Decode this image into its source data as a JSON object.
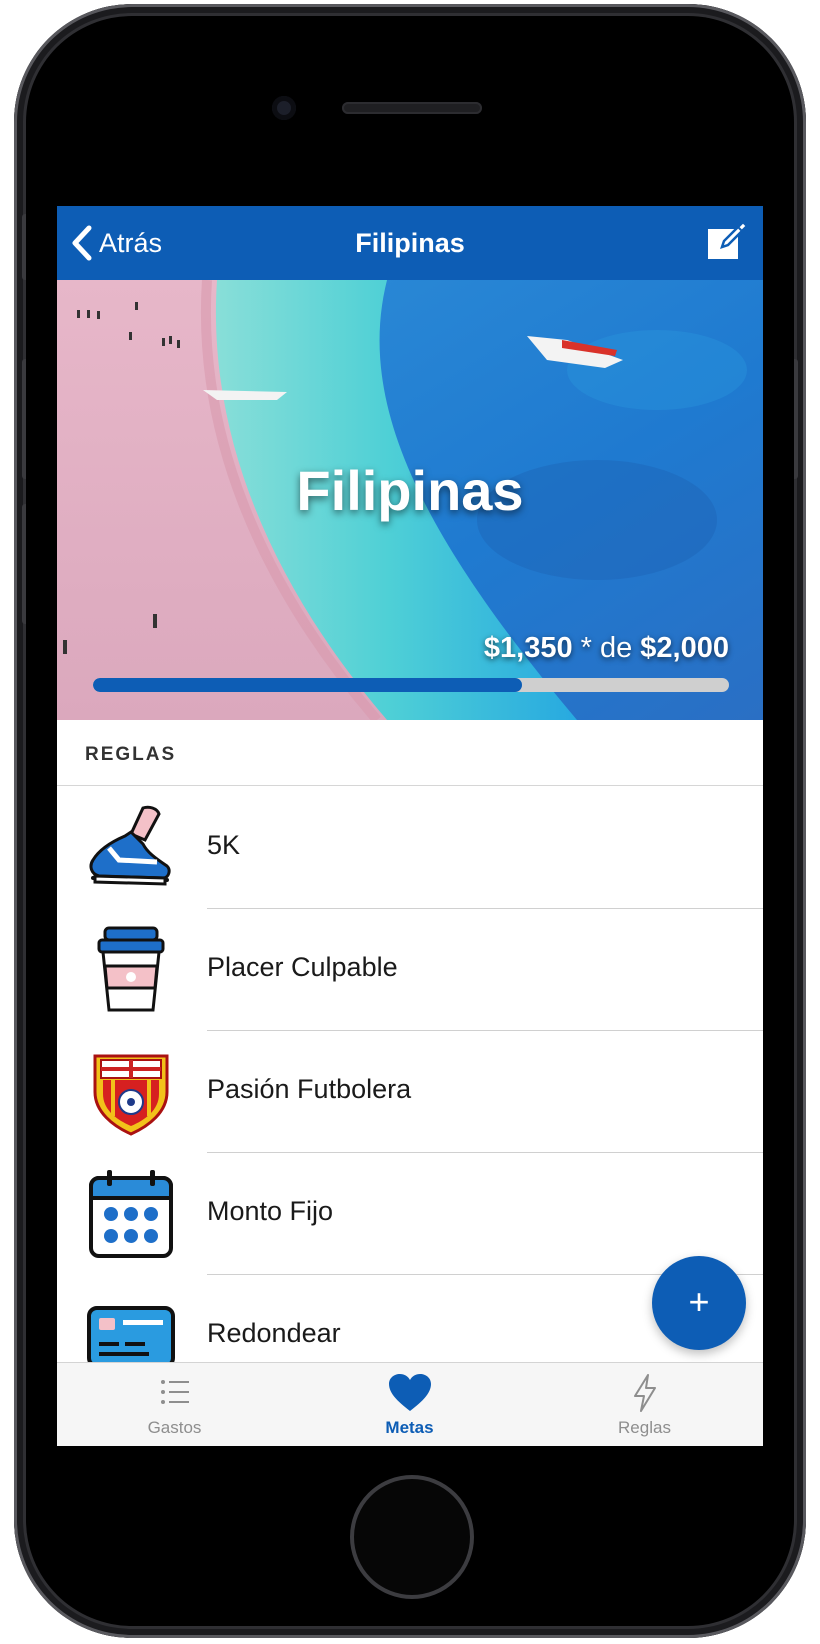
{
  "navbar": {
    "back_label": "Atrás",
    "title": "Filipinas"
  },
  "goal": {
    "name": "Filipinas",
    "saved": "$1,350",
    "saved_suffix": " * de ",
    "target": "$2,000",
    "progress_fraction": 0.675
  },
  "rules_section": {
    "header": "REGLAS",
    "items": [
      {
        "label": "5K",
        "icon": "running-shoe-icon"
      },
      {
        "label": "Placer Culpable",
        "icon": "coffee-cup-icon"
      },
      {
        "label": "Pasión Futbolera",
        "icon": "soccer-club-crest-icon"
      },
      {
        "label": "Monto Fijo",
        "icon": "calendar-icon"
      },
      {
        "label": "Redondear",
        "icon": "credit-card-icon"
      }
    ]
  },
  "fab": {
    "label": "+"
  },
  "tabbar": {
    "tabs": [
      {
        "label": "Gastos",
        "icon": "list-icon",
        "active": false
      },
      {
        "label": "Metas",
        "icon": "heart-icon",
        "active": true
      },
      {
        "label": "Reglas",
        "icon": "lightning-icon",
        "active": false
      }
    ]
  },
  "colors": {
    "primary": "#0d5db5",
    "inactive_tab": "#8e8e8e",
    "progress_track": "#cfcfcf"
  }
}
